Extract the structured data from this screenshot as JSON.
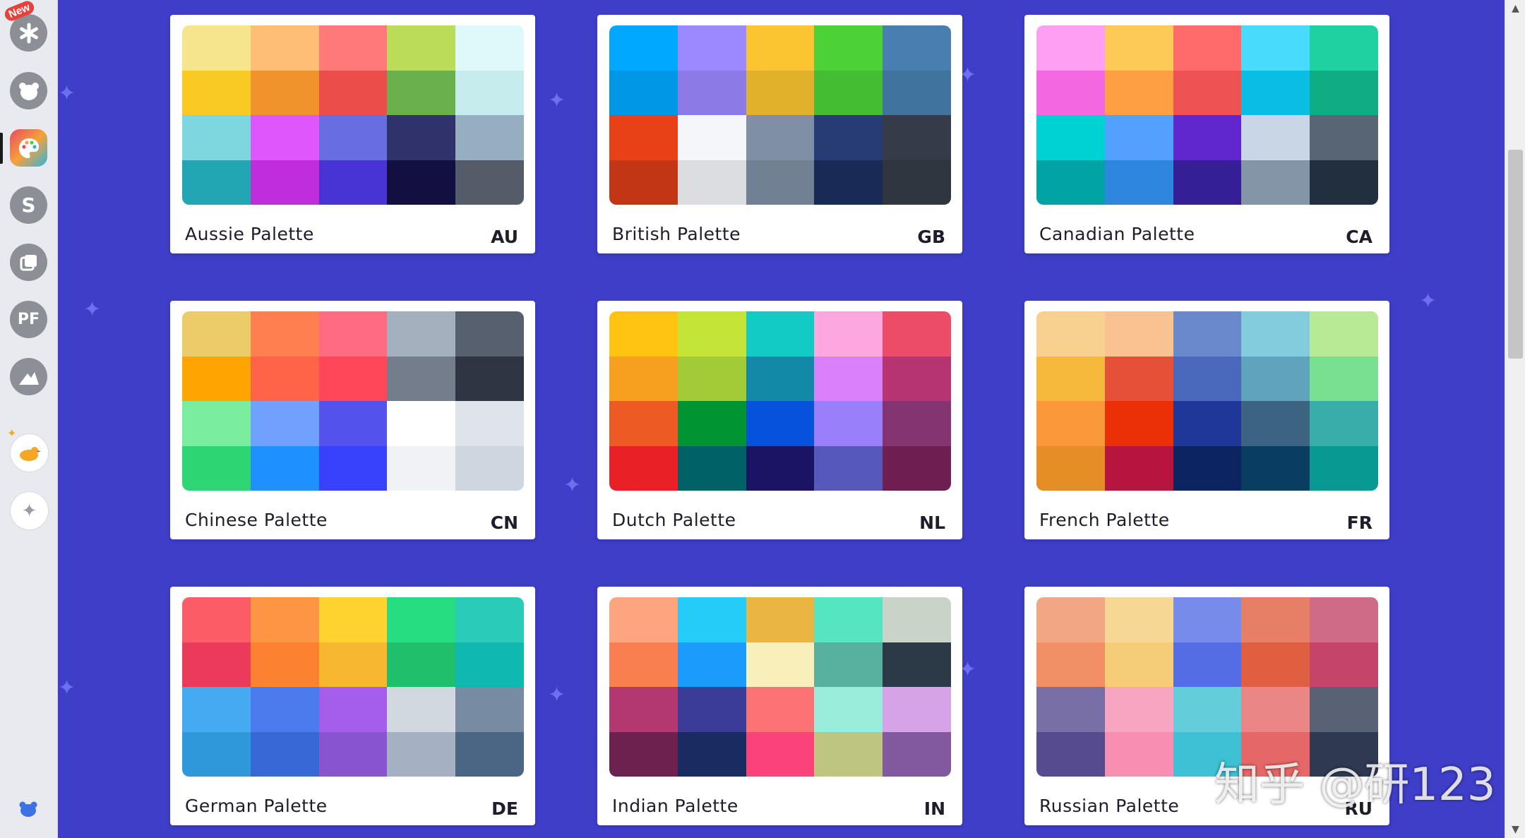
{
  "rail": {
    "new_badge": "New",
    "items": [
      {
        "name": "asterisk-app-icon",
        "active": false
      },
      {
        "name": "bear-app-icon",
        "active": false
      },
      {
        "name": "palette-app-icon",
        "active": true
      },
      {
        "name": "s-app-icon",
        "active": false,
        "glyph": "S"
      },
      {
        "name": "layers-app-icon",
        "active": false
      },
      {
        "name": "pf-app-icon",
        "active": false,
        "glyph": "PF"
      },
      {
        "name": "mountain-app-icon",
        "active": false
      },
      {
        "name": "duck-app-icon",
        "active": false
      },
      {
        "name": "sparkle-add-icon",
        "active": false
      }
    ]
  },
  "palettes": [
    {
      "name": "Aussie Palette",
      "code": "AU",
      "colors": [
        "#f6e58d",
        "#ffbe76",
        "#ff7979",
        "#badc58",
        "#dff9fb",
        "#f9ca24",
        "#f0932b",
        "#eb4d4b",
        "#6ab04c",
        "#c7ecee",
        "#7ed6df",
        "#e056fd",
        "#686de0",
        "#30336b",
        "#95afc0",
        "#22a6b3",
        "#be2edd",
        "#4834d4",
        "#130f40",
        "#535c68"
      ]
    },
    {
      "name": "British Palette",
      "code": "GB",
      "colors": [
        "#00a8ff",
        "#9c88ff",
        "#fbc531",
        "#4cd137",
        "#487eb0",
        "#0097e6",
        "#8c7ae6",
        "#e1b12c",
        "#44bd32",
        "#40739e",
        "#e84118",
        "#f5f6fa",
        "#7f8fa6",
        "#273c75",
        "#353b48",
        "#c23616",
        "#dcdde1",
        "#718093",
        "#192a56",
        "#2f3640"
      ]
    },
    {
      "name": "Canadian Palette",
      "code": "CA",
      "colors": [
        "#ff9ff3",
        "#feca57",
        "#ff6b6b",
        "#48dbfb",
        "#1dd1a1",
        "#f368e0",
        "#ff9f43",
        "#ee5253",
        "#0abde3",
        "#10ac84",
        "#00d2d3",
        "#54a0ff",
        "#5f27cd",
        "#c8d6e5",
        "#576574",
        "#01a3a4",
        "#2e86de",
        "#341f97",
        "#8395a7",
        "#222f3e"
      ]
    },
    {
      "name": "Chinese Palette",
      "code": "CN",
      "colors": [
        "#eccc68",
        "#ff7f50",
        "#ff6b81",
        "#a4b0be",
        "#57606f",
        "#ffa502",
        "#ff6348",
        "#ff4757",
        "#747d8c",
        "#2f3542",
        "#7bed9f",
        "#70a1ff",
        "#5352ed",
        "#ffffff",
        "#dfe4ea",
        "#2ed573",
        "#1e90ff",
        "#3742fa",
        "#f1f2f6",
        "#ced6e0"
      ]
    },
    {
      "name": "Dutch Palette",
      "code": "NL",
      "colors": [
        "#ffc312",
        "#c4e538",
        "#12cbc4",
        "#fda7df",
        "#ed4c67",
        "#f79f1f",
        "#a3cb38",
        "#1289a7",
        "#d980fa",
        "#b53471",
        "#ee5a24",
        "#009432",
        "#0652dd",
        "#9980fa",
        "#833471",
        "#ea2027",
        "#006266",
        "#1b1464",
        "#5758bb",
        "#6f1e51"
      ]
    },
    {
      "name": "French Palette",
      "code": "FR",
      "colors": [
        "#f8d090",
        "#f8c291",
        "#6a89cc",
        "#82ccdd",
        "#b8e994",
        "#f6b93b",
        "#e55039",
        "#4a69bd",
        "#60a3bc",
        "#78e08f",
        "#fa983a",
        "#eb2f06",
        "#1e3799",
        "#3c6382",
        "#38ada9",
        "#e58e26",
        "#b71540",
        "#0c2461",
        "#0a3d62",
        "#079992"
      ]
    },
    {
      "name": "German Palette",
      "code": "DE",
      "colors": [
        "#fc5c65",
        "#fd9644",
        "#fed330",
        "#26de81",
        "#2bcbba",
        "#eb3b5a",
        "#fa8231",
        "#f7b731",
        "#20bf6b",
        "#0fb9b1",
        "#45aaf2",
        "#4b7bec",
        "#a55eea",
        "#d1d8e0",
        "#778ca3",
        "#2d98da",
        "#3867d6",
        "#8854d0",
        "#a5b1c2",
        "#4b6584"
      ]
    },
    {
      "name": "Indian Palette",
      "code": "IN",
      "colors": [
        "#fea47f",
        "#25ccf7",
        "#eab543",
        "#55e6c1",
        "#cad3c8",
        "#f97f51",
        "#1b9cfc",
        "#f8efba",
        "#58b19f",
        "#2c3a47",
        "#b33771",
        "#3b3b98",
        "#fd7272",
        "#9aecdb",
        "#d6a2e8",
        "#6d214f",
        "#182c61",
        "#fc427b",
        "#bdc581",
        "#82589f"
      ]
    },
    {
      "name": "Russian Palette",
      "code": "RU",
      "colors": [
        "#f3a683",
        "#f7d794",
        "#778beb",
        "#e77f67",
        "#cf6a87",
        "#f19066",
        "#f5cd79",
        "#546de5",
        "#e15f41",
        "#c44569",
        "#786fa6",
        "#f8a5c2",
        "#63cdda",
        "#ea8685",
        "#596275",
        "#574b90",
        "#f78fb3",
        "#3dc1d3",
        "#e66767",
        "#303952"
      ]
    }
  ],
  "watermark": "知乎 @研123"
}
